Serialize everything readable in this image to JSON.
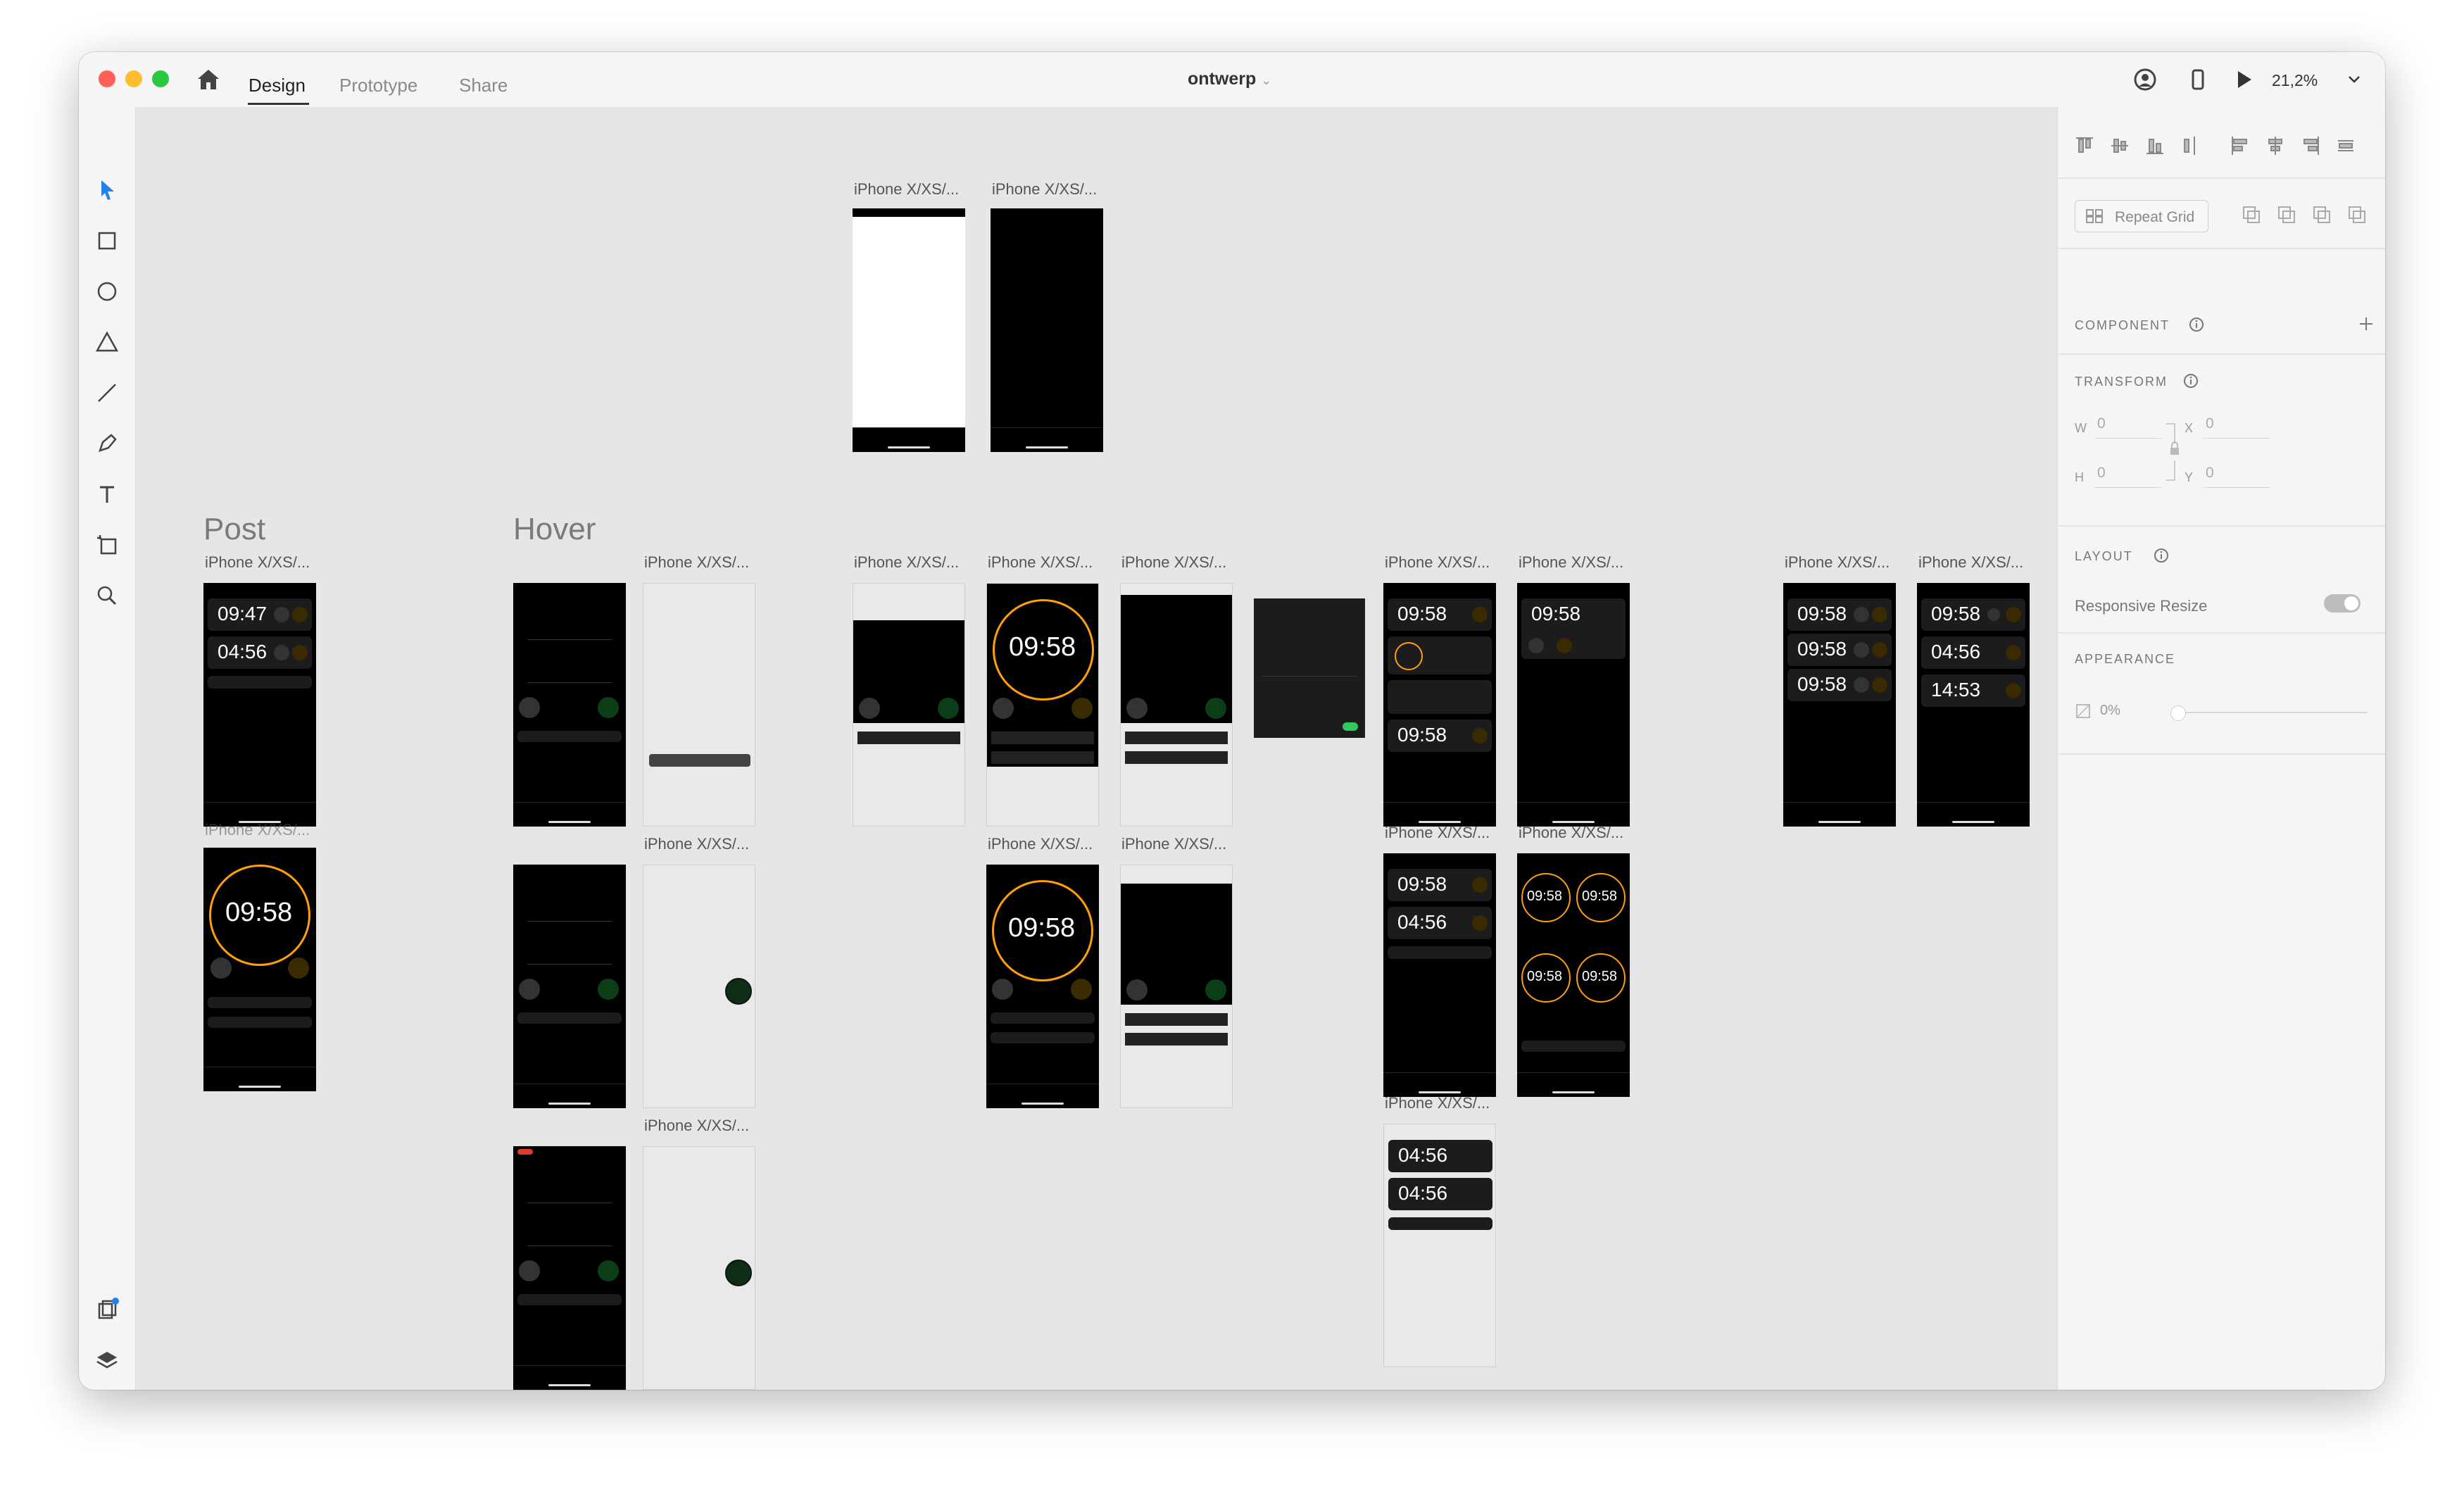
{
  "app": {
    "document_title": "ontwerp",
    "tabs": [
      {
        "label": "Design",
        "active": true
      },
      {
        "label": "Prototype",
        "active": false
      },
      {
        "label": "Share",
        "active": false
      }
    ],
    "zoom": "21,2%",
    "accent_color": "#ff9f0a"
  },
  "toolbar": {
    "tools": [
      "select-tool",
      "rectangle-tool",
      "ellipse-tool",
      "polygon-tool",
      "line-tool",
      "pen-tool",
      "text-tool",
      "artboard-tool",
      "zoom-tool"
    ],
    "bottom": [
      "assets-icon",
      "layers-icon",
      "plugins-icon"
    ]
  },
  "canvas": {
    "groups": {
      "post": "Post",
      "hover": "Hover"
    },
    "artboard_label": "iPhone X/XS/...",
    "timers": {
      "t0947": "09:47",
      "t0456": "04:56",
      "t0958": "09:58",
      "t1453": "14:53"
    }
  },
  "panel": {
    "repeat_grid": "Repeat Grid",
    "component": "COMPONENT",
    "transform": "TRANSFORM",
    "w_label": "W",
    "w_value": "0",
    "h_label": "H",
    "h_value": "0",
    "x_label": "X",
    "x_value": "0",
    "y_label": "Y",
    "y_value": "0",
    "layout": "LAYOUT",
    "responsive_resize": "Responsive Resize",
    "appearance": "APPEARANCE",
    "opacity": "0%"
  }
}
